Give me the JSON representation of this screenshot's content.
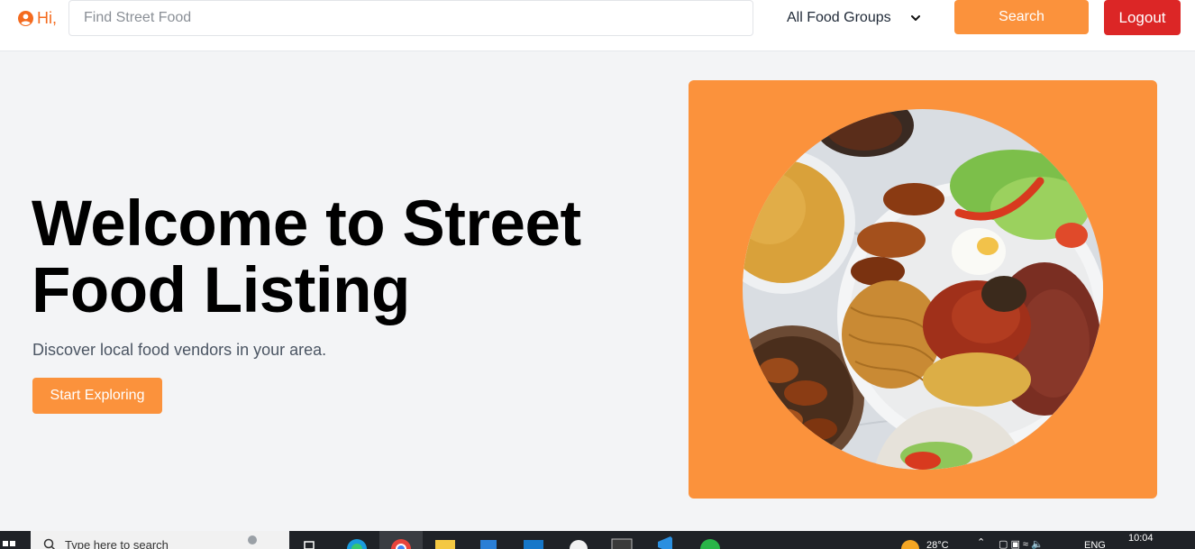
{
  "nav": {
    "greeting": "Hi,",
    "search_placeholder": "Find Street Food",
    "food_group_selected": "All Food Groups",
    "search_label": "Search",
    "logout_label": "Logout"
  },
  "hero": {
    "title_line1": "Welcome to Street",
    "title_line2": "Food Listing",
    "subtitle": "Discover local food vendors in your area.",
    "cta_label": "Start Exploring"
  },
  "taskbar": {
    "search_placeholder": "Type here to search",
    "weather": "28°C",
    "language": "ENG",
    "time": "10:04"
  },
  "colors": {
    "accent": "#fb923c",
    "logout": "#dc2626",
    "greeting": "#f46b1f",
    "background": "#f3f4f6"
  }
}
